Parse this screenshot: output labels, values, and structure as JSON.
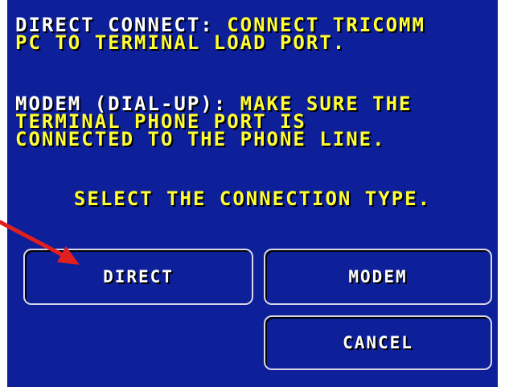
{
  "instructions": {
    "direct_label": "DIRECT CONNECT:",
    "direct_text_line1": "CONNECT TRICOMM",
    "direct_text_line2": "PC TO TERMINAL LOAD PORT.",
    "modem_label": "MODEM (DIAL-UP):",
    "modem_text_line1": "MAKE SURE THE",
    "modem_text_line2": "TERMINAL PHONE PORT IS",
    "modem_text_line3": "CONNECTED TO THE PHONE LINE."
  },
  "prompt": "SELECT THE CONNECTION TYPE.",
  "buttons": {
    "direct": "DIRECT",
    "modem": "MODEM",
    "cancel": "CANCEL"
  },
  "colors": {
    "background": "#0d1f99",
    "label_text": "#ffffff",
    "body_text": "#ffff33",
    "arrow": "#e02020"
  },
  "annotation": {
    "arrow_icon": "red-arrow-pointing-to-direct-button"
  }
}
